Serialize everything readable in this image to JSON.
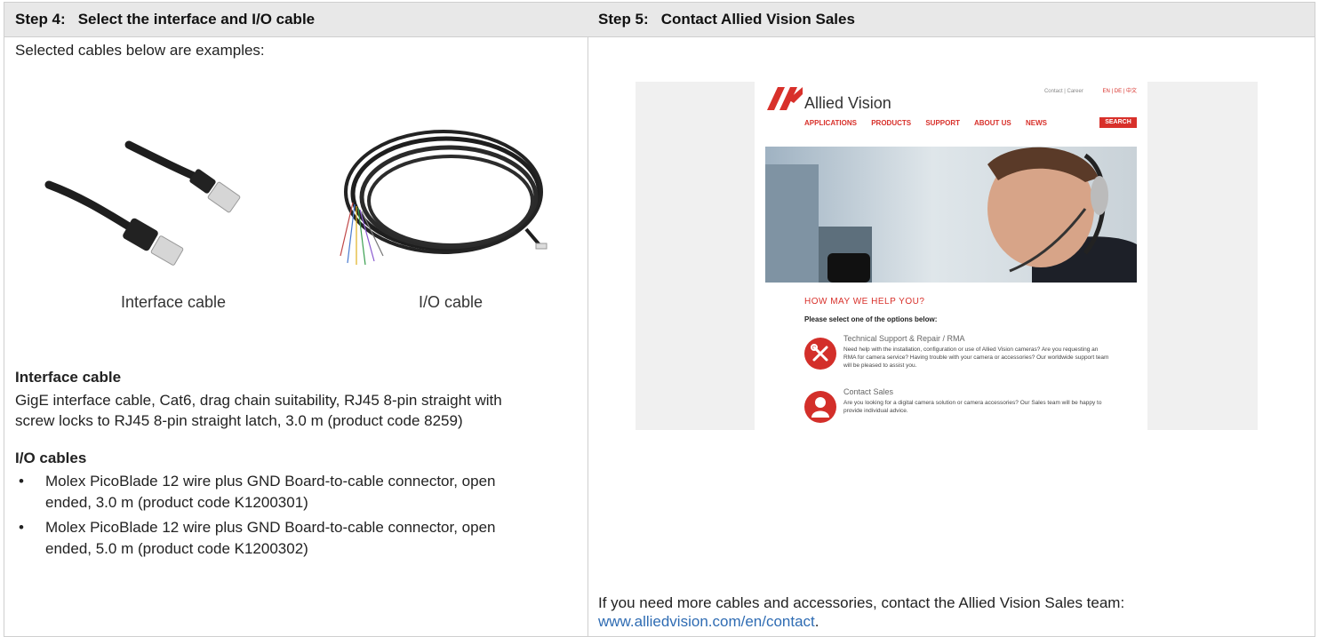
{
  "left": {
    "header": "Step 4:",
    "header_title": "Select the interface and I/O cable",
    "intro": "Selected cables below are examples:",
    "interface_caption": "Interface cable",
    "io_caption": "I/O cable",
    "interface_heading": "Interface cable",
    "interface_line1": "GigE interface cable, Cat6, drag chain suitability, RJ45 8-pin straight with",
    "interface_line2": "screw locks to RJ45 8-pin straight latch, 3.0 m (product code 8259)",
    "io_heading": "I/O cables",
    "io_items": [
      {
        "l1": "Molex PicoBlade 12 wire plus GND Board-to-cable connector, open",
        "l2": "ended, 3.0 m (product code K1200301)"
      },
      {
        "l1": "Molex PicoBlade 12 wire plus GND Board-to-cable connector, open",
        "l2": "ended, 5.0 m (product code K1200302)"
      }
    ]
  },
  "right": {
    "header": "Step 5:",
    "header_title": "Contact Allied Vision Sales",
    "footer_text": "If you need more cables and accessories, contact the Allied Vision Sales team:",
    "footer_link": "www.alliedvision.com/en/contact",
    "footer_period": ".",
    "website": {
      "logo": "Allied Vision",
      "toplinks": "Contact  |  Career",
      "lang": "EN  |  DE  |  中文",
      "nav": [
        "APPLICATIONS",
        "PRODUCTS",
        "SUPPORT",
        "ABOUT US",
        "NEWS"
      ],
      "search": "SEARCH",
      "help_title": "HOW MAY WE HELP YOU?",
      "select_text": "Please select one of the options below:",
      "opt1_title": "Technical Support & Repair / RMA",
      "opt1_desc": "Need help with the installation, configuration or use of Allied Vision cameras? Are you requesting an RMA for camera service? Having trouble with your camera or accessories? Our worldwide support team will be pleased to assist you.",
      "opt2_title": "Contact Sales",
      "opt2_desc": "Are you looking for a digital camera solution or camera accessories? Our Sales team will be happy to provide individual advice."
    }
  }
}
